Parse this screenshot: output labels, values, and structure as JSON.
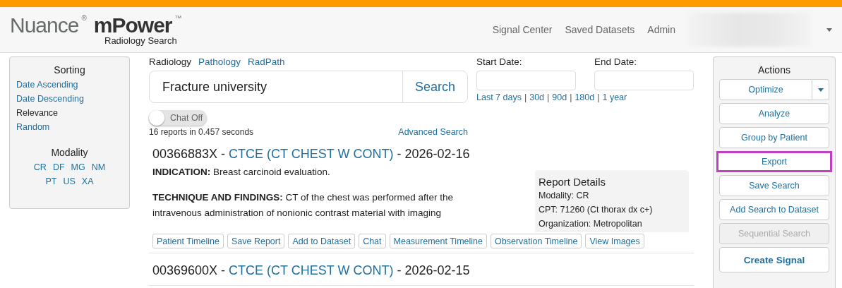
{
  "header": {
    "brand": "Nuance",
    "brand_mark": "®",
    "product": "mPower",
    "product_mark": "™",
    "subtitle": "Radiology Search",
    "nav": [
      "Signal Center",
      "Saved Datasets",
      "Admin"
    ],
    "user_menu": {
      "blurred": true
    }
  },
  "sidebar": {
    "sorting_title": "Sorting",
    "sorting": [
      {
        "label": "Date Ascending",
        "selected": false
      },
      {
        "label": "Date Descending",
        "selected": false
      },
      {
        "label": "Relevance",
        "selected": true
      },
      {
        "label": "Random",
        "selected": false
      }
    ],
    "modality_title": "Modality",
    "modalities": [
      [
        "CR",
        "DF",
        "MG",
        "NM"
      ],
      [
        "PT",
        "US",
        "XA"
      ]
    ]
  },
  "search": {
    "tabs": [
      {
        "label": "Radiology",
        "selected": true
      },
      {
        "label": "Pathology",
        "selected": false
      },
      {
        "label": "RadPath",
        "selected": false
      }
    ],
    "value": "Fracture university",
    "button": "Search",
    "chat_toggle": {
      "label": "Chat Off",
      "on": false
    },
    "stats": "16 reports in 0.457 seconds",
    "advanced": "Advanced Search"
  },
  "dates": {
    "start_label": "Start Date:",
    "end_label": "End Date:",
    "presets": [
      "Last 7 days",
      "30d",
      "90d",
      "180d",
      "1 year"
    ],
    "divider": "|"
  },
  "reports": [
    {
      "accession": "00366883X",
      "separator": "-",
      "exam": "CTCE (CT CHEST W CONT)",
      "date": "2026-02-16",
      "paragraphs": [
        "**INDICATION:** Breast carcinoid evaluation.",
        "**TECHNIQUE AND FINDINGS:** CT of the chest was performed after the intravenous administration of nonionic contrast material with imaging"
      ],
      "details_title": "Report Details",
      "details": [
        "Modality: CR",
        "CPT: 71260 (Ct thorax dx c+)",
        "Organization: Metropolitan"
      ],
      "buttons": [
        "Patient Timeline",
        "Save Report",
        "Add to Dataset",
        "Chat",
        "Measurement Timeline",
        "Observation Timeline",
        "View Images"
      ]
    },
    {
      "accession": "00369600X",
      "separator": "-",
      "exam": "CTCE (CT CHEST W CONT)",
      "date": "2026-02-15"
    }
  ],
  "actions": {
    "title": "Actions",
    "buttons": [
      {
        "label": "Optimize",
        "kind": "split",
        "disabled": false,
        "highlighted": false
      },
      {
        "label": "Analyze",
        "kind": "plain",
        "disabled": false,
        "highlighted": false
      },
      {
        "label": "Group by Patient",
        "kind": "plain",
        "disabled": false,
        "highlighted": false
      },
      {
        "label": "Export",
        "kind": "plain",
        "disabled": false,
        "highlighted": true
      },
      {
        "label": "Save Search",
        "kind": "plain",
        "disabled": false,
        "highlighted": false
      },
      {
        "label": "Add Search to Dataset",
        "kind": "plain",
        "disabled": false,
        "highlighted": false
      },
      {
        "label": "Sequential Search",
        "kind": "plain",
        "disabled": true,
        "highlighted": false
      },
      {
        "label": "Create Signal",
        "kind": "primary",
        "disabled": false,
        "highlighted": false
      }
    ]
  }
}
